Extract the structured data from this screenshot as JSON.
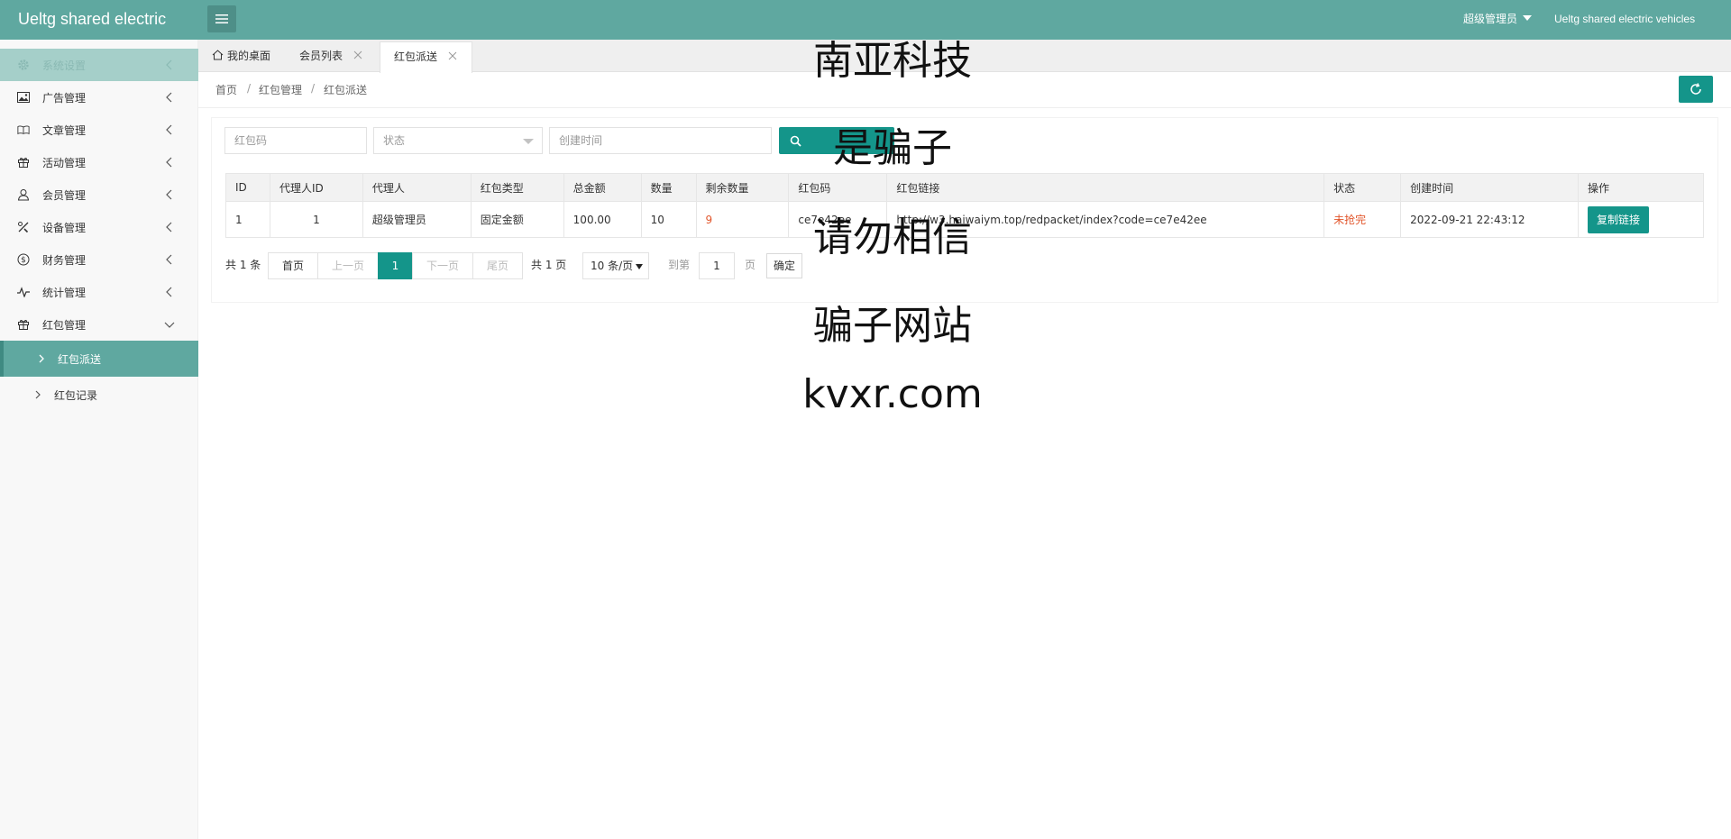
{
  "header": {
    "logo": "Ueltg shared electric",
    "admin": "超级管理员",
    "site": "Ueltg shared electric vehicles"
  },
  "sidebar": {
    "items": [
      {
        "label": "系统设置",
        "icon": "gear-icon"
      },
      {
        "label": "广告管理",
        "icon": "image-icon"
      },
      {
        "label": "文章管理",
        "icon": "book-icon"
      },
      {
        "label": "活动管理",
        "icon": "gift-icon"
      },
      {
        "label": "会员管理",
        "icon": "user-icon"
      },
      {
        "label": "设备管理",
        "icon": "tools-icon"
      },
      {
        "label": "财务管理",
        "icon": "dollar-icon"
      },
      {
        "label": "统计管理",
        "icon": "pulse-icon"
      },
      {
        "label": "红包管理",
        "icon": "gift-icon"
      }
    ],
    "sub": [
      {
        "label": "红包派送"
      },
      {
        "label": "红包记录"
      }
    ]
  },
  "tabs": [
    {
      "label": "我的桌面"
    },
    {
      "label": "会员列表"
    },
    {
      "label": "红包派送"
    }
  ],
  "breadcrumb": {
    "home": "首页",
    "sep": "/",
    "section": "红包管理",
    "page": "红包派送"
  },
  "filters": {
    "code_placeholder": "红包码",
    "status_placeholder": "状态",
    "time_placeholder": "创建时间"
  },
  "table": {
    "headers": [
      "ID",
      "代理人ID",
      "代理人",
      "红包类型",
      "总金额",
      "数量",
      "剩余数量",
      "红包码",
      "红包链接",
      "状态",
      "创建时间",
      "操作"
    ],
    "rows": [
      {
        "id": "1",
        "agent_id": "1",
        "agent": "超级管理员",
        "type": "固定金额",
        "amount": "100.00",
        "count": "10",
        "remaining": "9",
        "code": "ce7e42ee",
        "link": "http://w3.haiwaiym.top/redpacket/index?code=ce7e42ee",
        "status": "未抢完",
        "created": "2022-09-21 22:43:12",
        "action": "复制链接"
      }
    ]
  },
  "pagination": {
    "total": "共 1 条",
    "first": "首页",
    "prev": "上一页",
    "current": "1",
    "next": "下一页",
    "last": "尾页",
    "pages": "共 1 页",
    "page_size": "10 条/页",
    "goto": "到第",
    "goto_value": "1",
    "page_unit": "页",
    "confirm": "确定"
  },
  "watermark": [
    "南亚科技",
    "是骗子",
    "请勿相信",
    "骗子网站",
    "kvxr.com"
  ],
  "colors": {
    "header": "#5fa8a0",
    "accent": "#14958a",
    "warn": "#e2572d"
  }
}
